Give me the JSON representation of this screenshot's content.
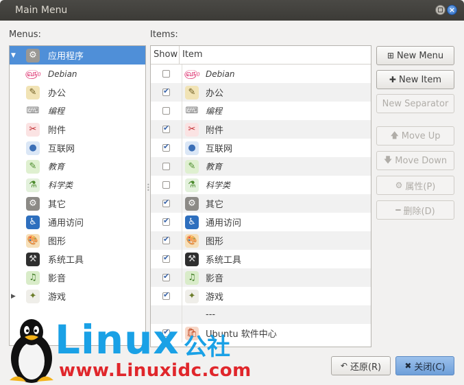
{
  "window": {
    "title": "Main Menu"
  },
  "labels": {
    "menus": "Menus:",
    "items": "Items:"
  },
  "menus": [
    {
      "label": "应用程序",
      "icon": "gear-icon",
      "italic": false,
      "selected": true,
      "expander": "▼"
    },
    {
      "label": "Debian",
      "icon": "debian-swirl-icon",
      "italic": true
    },
    {
      "label": "办公",
      "icon": "office-icon",
      "italic": false
    },
    {
      "label": "编程",
      "icon": "programming-icon",
      "italic": true
    },
    {
      "label": "附件",
      "icon": "accessories-icon",
      "italic": false
    },
    {
      "label": "互联网",
      "icon": "globe-icon",
      "italic": false
    },
    {
      "label": "教育",
      "icon": "education-icon",
      "italic": true
    },
    {
      "label": "科学类",
      "icon": "science-icon",
      "italic": true
    },
    {
      "label": "其它",
      "icon": "other-gear-icon",
      "italic": false
    },
    {
      "label": "通用访问",
      "icon": "accessibility-icon",
      "italic": false
    },
    {
      "label": "图形",
      "icon": "graphics-palette-icon",
      "italic": false
    },
    {
      "label": "系统工具",
      "icon": "system-tools-icon",
      "italic": false
    },
    {
      "label": "影音",
      "icon": "multimedia-icon",
      "italic": false
    },
    {
      "label": "游戏",
      "icon": "games-icon",
      "italic": false,
      "expander": "▶"
    }
  ],
  "table": {
    "col_show": "Show",
    "col_item": "Item",
    "rows": [
      {
        "show": false,
        "label": "Debian",
        "icon": "debian-swirl-icon",
        "italic": true
      },
      {
        "show": true,
        "label": "办公",
        "icon": "office-icon",
        "italic": false
      },
      {
        "show": false,
        "label": "编程",
        "icon": "programming-icon",
        "italic": true
      },
      {
        "show": true,
        "label": "附件",
        "icon": "accessories-icon",
        "italic": false
      },
      {
        "show": true,
        "label": "互联网",
        "icon": "globe-icon",
        "italic": false
      },
      {
        "show": false,
        "label": "教育",
        "icon": "education-icon",
        "italic": true
      },
      {
        "show": false,
        "label": "科学类",
        "icon": "science-icon",
        "italic": true
      },
      {
        "show": true,
        "label": "其它",
        "icon": "other-gear-icon",
        "italic": false
      },
      {
        "show": true,
        "label": "通用访问",
        "icon": "accessibility-icon",
        "italic": false
      },
      {
        "show": true,
        "label": "图形",
        "icon": "graphics-palette-icon",
        "italic": false
      },
      {
        "show": true,
        "label": "系统工具",
        "icon": "system-tools-icon",
        "italic": false
      },
      {
        "show": true,
        "label": "影音",
        "icon": "multimedia-icon",
        "italic": false
      },
      {
        "show": true,
        "label": "游戏",
        "icon": "games-icon",
        "italic": false
      },
      {
        "show": null,
        "label": "---",
        "icon": null,
        "italic": false,
        "separator": true
      },
      {
        "show": true,
        "label": "Ubuntu 软件中心",
        "icon": "software-center-icon",
        "italic": false
      }
    ]
  },
  "buttons": {
    "new_menu": "New Menu",
    "new_item": "New Item",
    "new_separator": "New Separator",
    "move_up": "Move Up",
    "move_down": "Move Down",
    "properties": "属性(P)",
    "delete": "删除(D)",
    "revert": "还原(R)",
    "close": "关闭(C)"
  },
  "watermark": {
    "brand": "Linux",
    "brand_cn": "公社",
    "url": "www.Linuxidc.com"
  },
  "colors": {
    "selection": "#4f8fd8",
    "titlebar": "#3c3b37",
    "accent_blue": "#1aa1e6",
    "watermark_red": "#e0262b"
  }
}
